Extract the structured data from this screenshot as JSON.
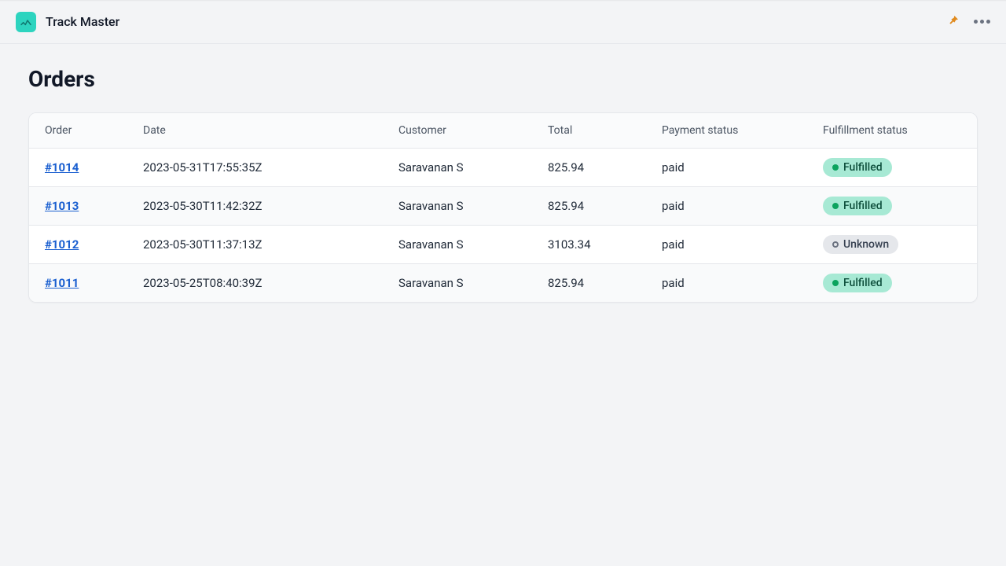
{
  "header": {
    "app_title": "Track Master"
  },
  "page": {
    "title": "Orders"
  },
  "table": {
    "columns": {
      "order": "Order",
      "date": "Date",
      "customer": "Customer",
      "total": "Total",
      "payment_status": "Payment status",
      "fulfillment_status": "Fulfillment status"
    },
    "rows": [
      {
        "order": "#1014",
        "date": "2023-05-31T17:55:35Z",
        "customer": "Saravanan S",
        "total": "825.94",
        "payment_status": "paid",
        "fulfillment_status": "Fulfilled",
        "fulfillment_kind": "fulfilled"
      },
      {
        "order": "#1013",
        "date": "2023-05-30T11:42:32Z",
        "customer": "Saravanan S",
        "total": "825.94",
        "payment_status": "paid",
        "fulfillment_status": "Fulfilled",
        "fulfillment_kind": "fulfilled"
      },
      {
        "order": "#1012",
        "date": "2023-05-30T11:37:13Z",
        "customer": "Saravanan S",
        "total": "3103.34",
        "payment_status": "paid",
        "fulfillment_status": "Unknown",
        "fulfillment_kind": "unknown"
      },
      {
        "order": "#1011",
        "date": "2023-05-25T08:40:39Z",
        "customer": "Saravanan S",
        "total": "825.94",
        "payment_status": "paid",
        "fulfillment_status": "Fulfilled",
        "fulfillment_kind": "fulfilled"
      }
    ]
  }
}
